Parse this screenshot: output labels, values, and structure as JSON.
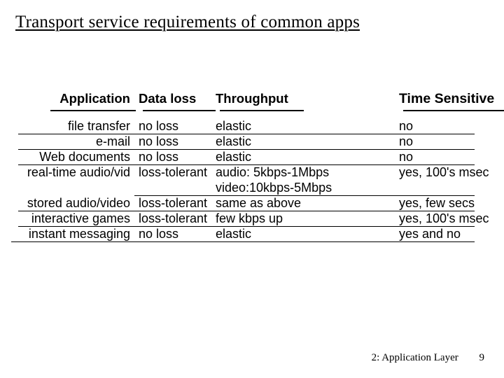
{
  "title": "Transport service requirements of common apps",
  "headers": {
    "app": "Application",
    "loss": "Data loss",
    "thr": "Throughput",
    "time": "Time Sensitive"
  },
  "rows": [
    {
      "app": "file transfer",
      "loss": "no loss",
      "thr": "elastic",
      "time": "no",
      "rule": "urule-full"
    },
    {
      "app": "e-mail",
      "loss": "no loss",
      "thr": "elastic",
      "time": "no",
      "rule": "urule-full"
    },
    {
      "app": "Web documents",
      "loss": "no loss",
      "thr": "elastic",
      "time": "no",
      "rule": "urule-full"
    },
    {
      "app": "real-time audio/vid",
      "loss": "loss-tolerant",
      "thr": "audio: 5kbps-1Mbps",
      "time": "yes, 100's msec",
      "rule": ""
    },
    {
      "app": "",
      "loss": "",
      "thr": "video:10kbps-5Mbps",
      "time": "",
      "rule": "urule-end"
    },
    {
      "app": "stored audio/video",
      "loss": "loss-tolerant",
      "thr": "same as above",
      "time": "yes, few secs",
      "rule": "urule-full"
    },
    {
      "app": " interactive games",
      "loss": "loss-tolerant",
      "thr": "few kbps up",
      "time": "yes, 100's msec",
      "rule": "urule-full"
    },
    {
      "app": "instant messaging",
      "loss": "no loss",
      "thr": "elastic",
      "time": "yes and no",
      "rule": "urule-last"
    }
  ],
  "footer": {
    "chapter": "2: Application Layer",
    "page": "9"
  },
  "chart_data": {
    "type": "table",
    "title": "Transport service requirements of common apps",
    "columns": [
      "Application",
      "Data loss",
      "Throughput",
      "Time Sensitive"
    ],
    "rows": [
      [
        "file transfer",
        "no loss",
        "elastic",
        "no"
      ],
      [
        "e-mail",
        "no loss",
        "elastic",
        "no"
      ],
      [
        "Web documents",
        "no loss",
        "elastic",
        "no"
      ],
      [
        "real-time audio/video",
        "loss-tolerant",
        "audio: 5kbps-1Mbps; video: 10kbps-5Mbps",
        "yes, 100's msec"
      ],
      [
        "stored audio/video",
        "loss-tolerant",
        "same as above",
        "yes, few secs"
      ],
      [
        "interactive games",
        "loss-tolerant",
        "few kbps up",
        "yes, 100's msec"
      ],
      [
        "instant messaging",
        "no loss",
        "elastic",
        "yes and no"
      ]
    ]
  }
}
